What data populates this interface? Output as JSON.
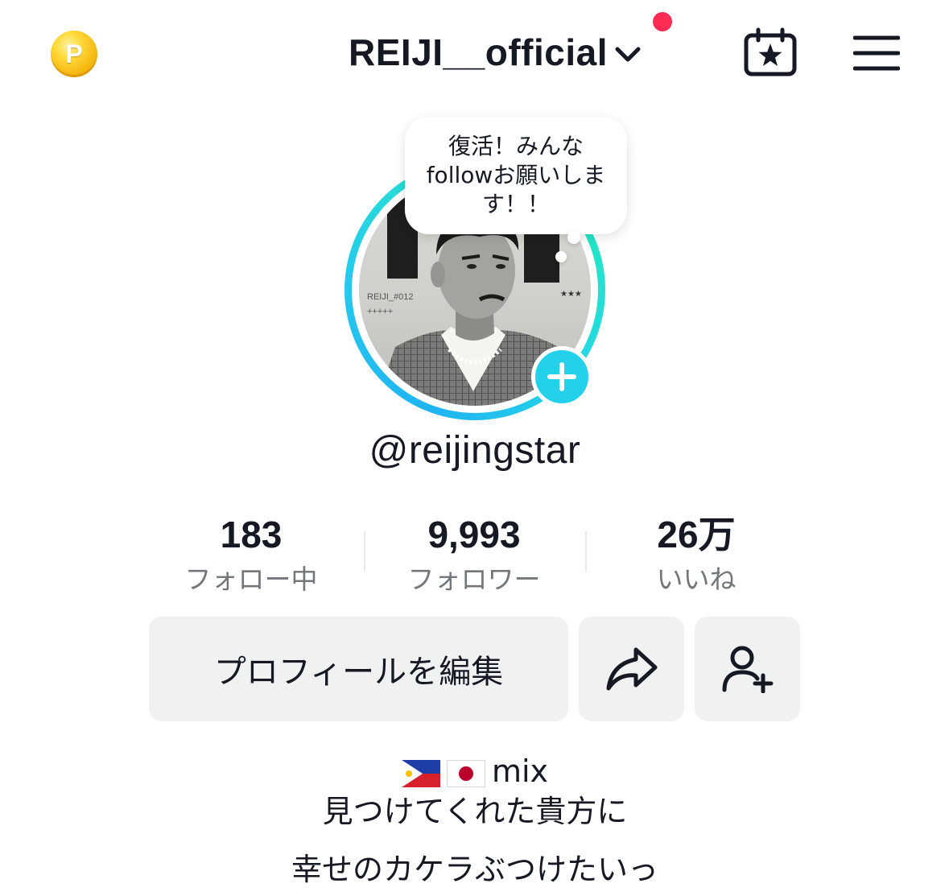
{
  "topbar": {
    "coin_symbol": "P",
    "username": "REIJI__official",
    "notification": "unread",
    "icons": [
      "coin-icon",
      "chevron-down-icon",
      "calendar-star-icon",
      "hamburger-menu-icon"
    ]
  },
  "avatar": {
    "note": "復活！みんなfollowお願いします！！",
    "photo_text_left": "REIJI_#012",
    "photo_text_plus": "+++++",
    "photo_text_stars": "★★★",
    "add_icon": "plus-icon"
  },
  "handle": "@reijingstar",
  "stats": [
    {
      "value": "183",
      "label": "フォロー中"
    },
    {
      "value": "9,993",
      "label": "フォロワー"
    },
    {
      "value": "26万",
      "label": "いいね"
    }
  ],
  "actions": {
    "edit_profile": "プロフィールを編集",
    "share_icon": "share-arrow-icon",
    "add_friend_icon": "add-friend-icon"
  },
  "bio": {
    "flags": [
      "philippines-flag",
      "japan-flag"
    ],
    "line1_text": "mix",
    "line2": "見つけてくれた貴方に",
    "line3": "幸せのカケラぶつけたいっ"
  },
  "colors": {
    "accent_cyan": "#23d2ea",
    "notification_red": "#fe2c55",
    "button_bg": "#f1f1f2",
    "secondary_text": "#75767c"
  }
}
